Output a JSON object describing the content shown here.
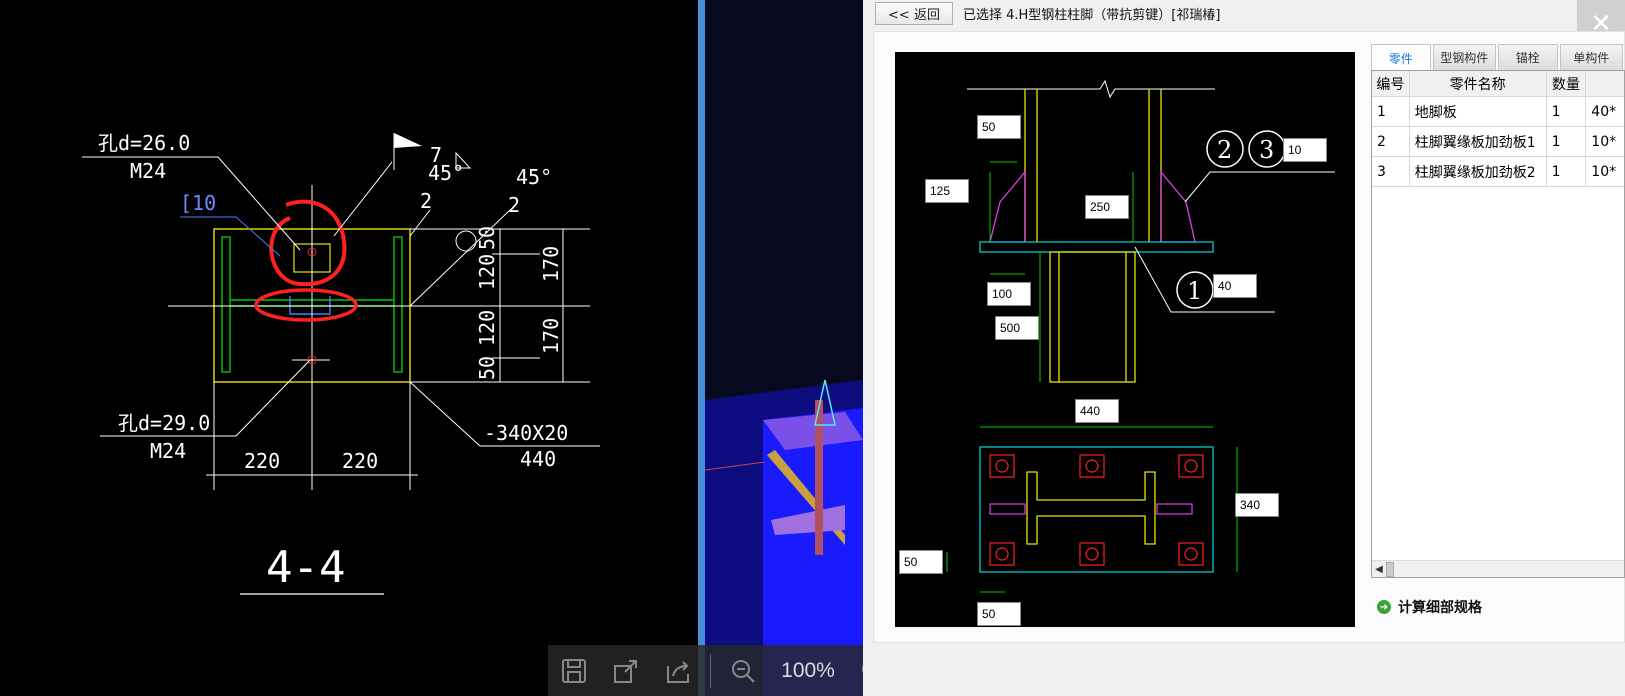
{
  "header": {
    "back_label": "<< 返回",
    "selected_text": "已选择  4.H型钢柱柱脚（带抗剪键）[祁瑞椿]",
    "close_glyph": "✕"
  },
  "toolbar": {
    "zoom": "100%"
  },
  "cad_left": {
    "hole_top": "孔d=26.0",
    "bolt_top": "M24",
    "channel": "[10",
    "hole_bottom": "孔d=29.0",
    "bolt_bottom": "M24",
    "angle_1": "45°",
    "angle_2": "45°",
    "weld_1": "2",
    "weld_2": "2",
    "weld_7": "7",
    "dim_50a": "50",
    "dim_120a": "120",
    "dim_120b": "120",
    "dim_50b": "50",
    "dim_170a": "170",
    "dim_170b": "170",
    "plate": "-340X20",
    "plate_len": "440",
    "dim_220a": "220",
    "dim_220b": "220",
    "section": "4-4"
  },
  "preview": {
    "dims": [
      "50",
      "125",
      "250",
      "10",
      "100",
      "500",
      "40",
      "440",
      "340",
      "50",
      "50"
    ],
    "callouts": [
      "2",
      "3",
      "1"
    ]
  },
  "tabs": [
    {
      "label": "零件",
      "active": true
    },
    {
      "label": "型钢构件",
      "active": false
    },
    {
      "label": "锚栓",
      "active": false
    },
    {
      "label": "单构件",
      "active": false
    }
  ],
  "table": {
    "columns": [
      "编号",
      "零件名称",
      "数量",
      ""
    ],
    "rows": [
      {
        "no": "1",
        "name": "地脚板",
        "qty": "1",
        "spec": "40*"
      },
      {
        "no": "2",
        "name": "柱脚翼缘板加劲板1",
        "qty": "1",
        "spec": "10*"
      },
      {
        "no": "3",
        "name": "柱脚翼缘板加劲板2",
        "qty": "1",
        "spec": "10*"
      }
    ]
  },
  "calc": {
    "label": "计算细部规格"
  },
  "colors": {
    "cad_line": "#ffffff",
    "cad_yellow": "#e6e600",
    "cad_green": "#00c800",
    "cad_red_mark": "#ff2020",
    "cad_cyan": "#00c8d0",
    "cad_magenta": "#e040e0",
    "tab_active": "#1a73d9"
  }
}
